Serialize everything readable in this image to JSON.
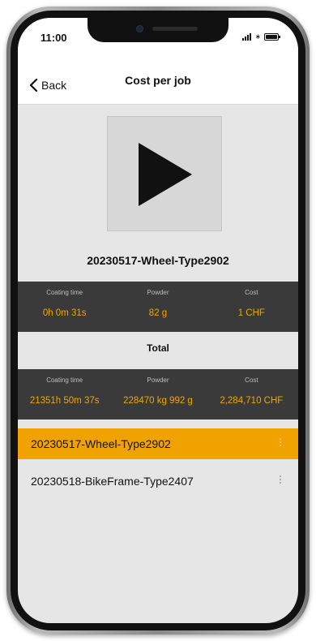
{
  "status_bar": {
    "time": "11:00"
  },
  "nav": {
    "back_label": "Back",
    "title": "Cost per job"
  },
  "media": {
    "icon": "play-icon"
  },
  "job": {
    "name": "20230517-Wheel-Type2902",
    "stats": [
      {
        "label": "Coating time",
        "value": "0h 0m 31s"
      },
      {
        "label": "Powder",
        "value": "82 g"
      },
      {
        "label": "Cost",
        "value": "1 CHF"
      }
    ]
  },
  "total": {
    "title": "Total",
    "stats": [
      {
        "label": "Coating time",
        "value": "21351h 50m 37s"
      },
      {
        "label": "Powder",
        "value": "228470 kg 992 g"
      },
      {
        "label": "Cost",
        "value": "2,284,710 CHF"
      }
    ]
  },
  "jobs_list": [
    {
      "name": "20230517-Wheel-Type2902",
      "selected": true
    },
    {
      "name": "20230518-BikeFrame-Type2407",
      "selected": false
    }
  ],
  "colors": {
    "accent": "#f0a300",
    "stats_bg": "#3a3a3a",
    "screen_bg": "#e6e6e6"
  }
}
